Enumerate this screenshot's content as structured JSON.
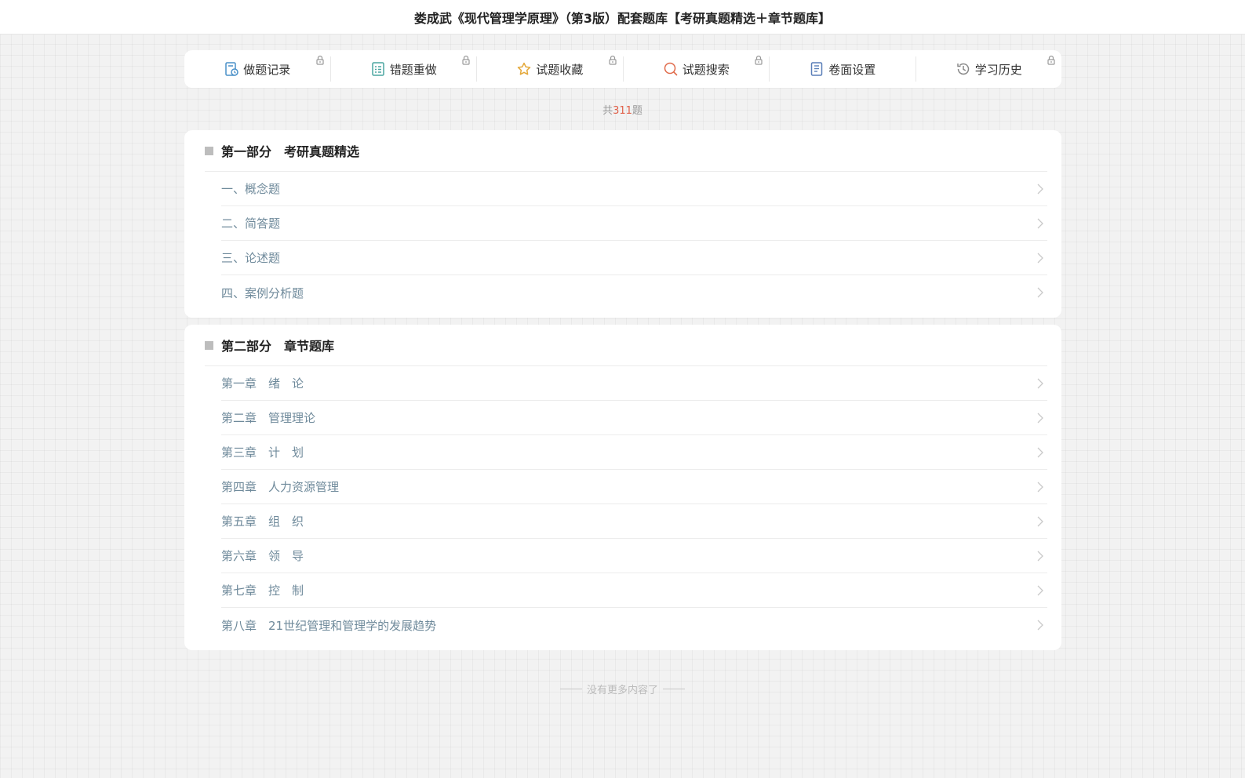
{
  "header": {
    "title": "娄成武《现代管理学原理》（第3版）配套题库【考研真题精选＋章节题库】"
  },
  "toolbar": {
    "items": [
      {
        "label": "做题记录",
        "icon": "record-icon",
        "color": "#4a90c8"
      },
      {
        "label": "错题重做",
        "icon": "list-icon",
        "color": "#4aa5a0"
      },
      {
        "label": "试题收藏",
        "icon": "star-icon",
        "color": "#e4a83a"
      },
      {
        "label": "试题搜索",
        "icon": "search-icon",
        "color": "#e06a4a"
      },
      {
        "label": "卷面设置",
        "icon": "document-icon",
        "color": "#5a7fb8"
      },
      {
        "label": "学习历史",
        "icon": "history-icon",
        "color": "#888888"
      }
    ],
    "lock_icon": "lock-icon"
  },
  "summary": {
    "prefix": "共",
    "count": "311",
    "suffix": "题"
  },
  "sections": [
    {
      "title": "第一部分　考研真题精选",
      "items": [
        "一、概念题",
        "二、简答题",
        "三、论述题",
        "四、案例分析题"
      ]
    },
    {
      "title": "第二部分　章节题库",
      "items": [
        "第一章　绪　论",
        "第二章　管理理论",
        "第三章　计　划",
        "第四章　人力资源管理",
        "第五章　组　织",
        "第六章　领　导",
        "第七章　控　制",
        "第八章　21世纪管理和管理学的发展趋势"
      ]
    }
  ],
  "footer": {
    "text": "没有更多内容了"
  }
}
